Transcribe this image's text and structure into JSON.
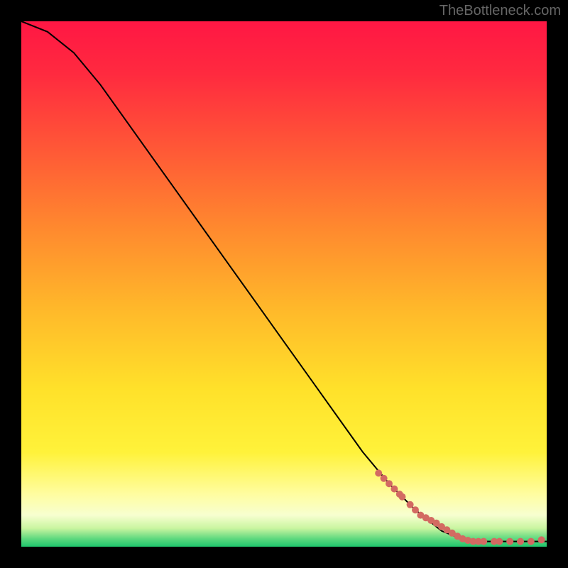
{
  "watermark": "TheBottleneck.com",
  "chart_data": {
    "type": "line",
    "title": "",
    "xlabel": "",
    "ylabel": "",
    "xlim": [
      0,
      100
    ],
    "ylim": [
      0,
      100
    ],
    "grid": false,
    "series": [
      {
        "name": "bottleneck-curve",
        "description": "Black curve showing inverse relation, starts at top-left, descends nearly linearly to bottom-right, then flattens near x≈85 at y≈1",
        "x": [
          0,
          5,
          10,
          15,
          20,
          25,
          30,
          35,
          40,
          45,
          50,
          55,
          60,
          65,
          70,
          75,
          80,
          85,
          90,
          95,
          100
        ],
        "y": [
          100,
          98,
          94,
          88,
          81,
          74,
          67,
          60,
          53,
          46,
          39,
          32,
          25,
          18,
          12,
          7,
          3,
          1,
          1,
          1,
          1
        ]
      }
    ],
    "highlight_points": {
      "description": "dense cluster of salmon dots along the curve from roughly x=68 to x=100",
      "color": "#d36a62",
      "points": [
        [
          68,
          14
        ],
        [
          69,
          13
        ],
        [
          70,
          12
        ],
        [
          71,
          11
        ],
        [
          72,
          10
        ],
        [
          72.5,
          9.5
        ],
        [
          74,
          8
        ],
        [
          75,
          7
        ],
        [
          76,
          6
        ],
        [
          77,
          5.5
        ],
        [
          78,
          5
        ],
        [
          79,
          4.5
        ],
        [
          80,
          3.8
        ],
        [
          81,
          3.2
        ],
        [
          82,
          2.6
        ],
        [
          83,
          2
        ],
        [
          84,
          1.5
        ],
        [
          85,
          1.2
        ],
        [
          86,
          1
        ],
        [
          87,
          1
        ],
        [
          88,
          1
        ],
        [
          90,
          1
        ],
        [
          91,
          1
        ],
        [
          93,
          1
        ],
        [
          95,
          1
        ],
        [
          97,
          1
        ],
        [
          99,
          1.3
        ]
      ]
    },
    "background_gradient": {
      "description": "Vertical gradient from red (top) through orange, yellow, pale yellow, to green (very bottom)",
      "stops": [
        {
          "pos": 0.0,
          "color": "#ff1744"
        },
        {
          "pos": 0.1,
          "color": "#ff2a3f"
        },
        {
          "pos": 0.25,
          "color": "#ff5a36"
        },
        {
          "pos": 0.4,
          "color": "#ff8b2e"
        },
        {
          "pos": 0.55,
          "color": "#ffb92a"
        },
        {
          "pos": 0.7,
          "color": "#ffe12a"
        },
        {
          "pos": 0.82,
          "color": "#fff23a"
        },
        {
          "pos": 0.9,
          "color": "#fffda0"
        },
        {
          "pos": 0.94,
          "color": "#f7ffd0"
        },
        {
          "pos": 0.965,
          "color": "#c9f5a0"
        },
        {
          "pos": 0.985,
          "color": "#5dd87e"
        },
        {
          "pos": 1.0,
          "color": "#1fc66d"
        }
      ]
    }
  }
}
